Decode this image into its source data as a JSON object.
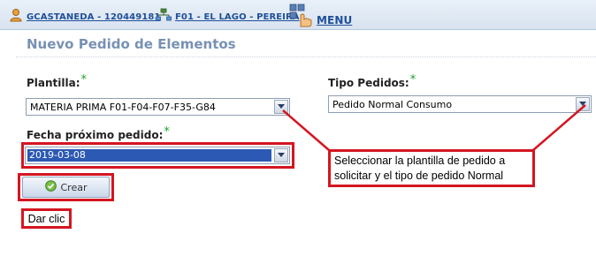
{
  "header": {
    "user_label": "GCASTANEDA - 120449181",
    "office_label": "F01 - EL LAGO - PEREIRA",
    "menu_label": "MENU"
  },
  "page": {
    "title": "Nuevo Pedido de Elementos"
  },
  "form": {
    "plantilla": {
      "label": "Plantilla:",
      "required_mark": "*",
      "value": "MATERIA PRIMA F01-F04-F07-F35-G84"
    },
    "tipo_pedidos": {
      "label": "Tipo Pedidos:",
      "required_mark": "*",
      "value": "Pedido Normal Consumo"
    },
    "fecha": {
      "label": "Fecha próximo pedido:",
      "required_mark": "*",
      "value": "2019-03-08"
    },
    "crear_button": "Crear"
  },
  "annotations": {
    "callout_text": "Seleccionar la plantilla de pedido a solicitar y el tipo de pedido Normal",
    "click_note": "Dar clic",
    "highlight_color": "#d41621"
  },
  "colors": {
    "title": "#7891b4",
    "link": "#1f4f9a",
    "required": "#1aa12e",
    "selection": "#2c59b4"
  },
  "icons": [
    "user-icon",
    "office-network-icon",
    "menu-hand-icon",
    "chevron-down-icon",
    "check-circle-icon"
  ]
}
